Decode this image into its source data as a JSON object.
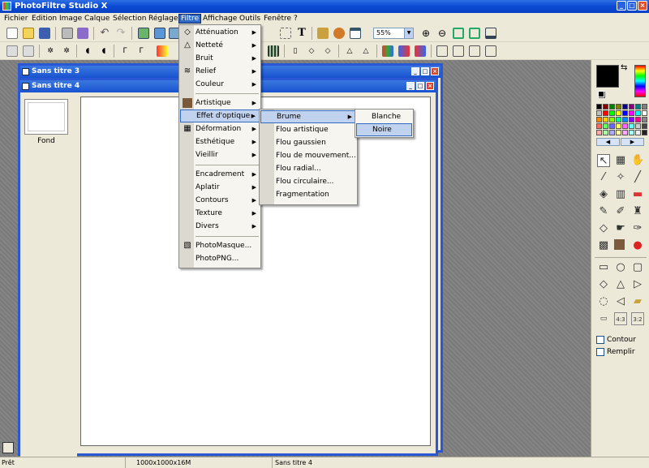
{
  "app": {
    "title": "PhotoFiltre Studio X"
  },
  "menubar": [
    "Fichier",
    "Edition",
    "Image",
    "Calque",
    "Sélection",
    "Réglage",
    "Filtre",
    "Affichage",
    "Outils",
    "Fenêtre",
    "?"
  ],
  "toolbar": {
    "zoom": "55%"
  },
  "documents": {
    "back": {
      "title": "Sans titre 3"
    },
    "front": {
      "title": "Sans titre 4",
      "layer_label": "Fond"
    }
  },
  "filter_menu": {
    "items": [
      "Atténuation",
      "Netteté",
      "Bruit",
      "Relief",
      "Couleur",
      "Artistique",
      "Effet d'optique",
      "Déformation",
      "Esthétique",
      "Vieillir",
      "Encadrement",
      "Aplatir",
      "Contours",
      "Texture",
      "Divers",
      "PhotoMasque...",
      "PhotoPNG..."
    ]
  },
  "optics_menu": {
    "items": [
      "Brume",
      "Flou artistique",
      "Flou gaussien",
      "Flou de mouvement...",
      "Flou radial...",
      "Flou circulaire...",
      "Fragmentation"
    ]
  },
  "fog_menu": {
    "items": [
      "Blanche",
      "Noire"
    ]
  },
  "right_panel": {
    "contour_label": "Contour",
    "fill_label": "Remplir"
  },
  "status": {
    "ready": "Prêt",
    "size": "1000x1000x16M",
    "doc": "Sans titre 4"
  }
}
